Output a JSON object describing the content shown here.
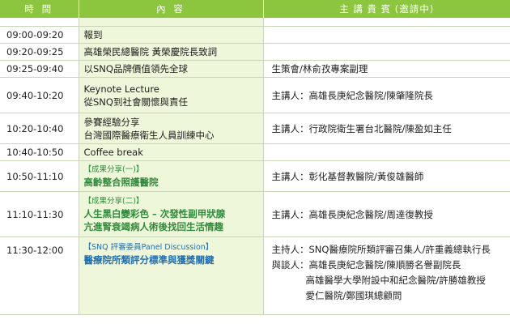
{
  "headers": {
    "time": "時 間",
    "content": "內 容",
    "host": "主 講 貴 賓 (邀請中)"
  },
  "rows": [
    {
      "time": "09:00-09:20",
      "content": [
        "報到"
      ],
      "host": []
    },
    {
      "time": "09:20-09:25",
      "content": [
        "高雄榮民總醫院 黃榮慶院長致詞"
      ],
      "host": []
    },
    {
      "time": "09:25-09:40",
      "content": [
        "以SNQ品牌價值領先全球"
      ],
      "host": [
        "生策會/林俞孜專案副理"
      ]
    },
    {
      "time": "09:40-10:20",
      "content": [
        "Keynote Lecture",
        "從SNQ到社會關懷與責任"
      ],
      "host": [
        "主講人：高雄長庚紀念醫院/陳肇隆院長"
      ]
    },
    {
      "time": "10:20-10:40",
      "content": [
        "參賽經驗分享",
        "台灣國際醫療衛生人員訓練中心"
      ],
      "host": [
        "主講人：行政院衛生署台北醫院/陳盈如主任"
      ]
    },
    {
      "time": "10:40-10:50",
      "content": [
        "Coffee break"
      ],
      "host": []
    },
    {
      "time": "10:50-11:10",
      "tag": "【成果分享(一)】",
      "title": [
        "高齡整合照護醫院"
      ],
      "style": "green",
      "host": [
        "主講人：彰化基督教醫院/黃俊雄醫師"
      ]
    },
    {
      "time": "11:10-11:30",
      "tag": "【成果分享(二)】",
      "title": [
        "人生黑白變彩色 – 次發性副甲狀腺",
        "亢進腎衰竭病人術後找回生活情趣"
      ],
      "style": "green",
      "host": [
        "主講人：高雄長庚紀念醫院/周達復教授"
      ]
    },
    {
      "time": "11:30-12:00",
      "tag": "【SNQ 評審委員Panel Discussion】",
      "title": [
        "醫療院所類評分標準與獲獎關鍵"
      ],
      "style": "blue",
      "host_lead": "主持人：SNQ醫療院所類評審召集人/許重義總執行長",
      "host_panel_label": "與談人：",
      "host_panel": [
        "高雄長庚紀念醫院/陳順勝名譽副院長",
        "高雄醫學大學附設中和紀念醫院/許勝雄教授",
        "愛仁醫院/鄭國琪總顧問"
      ]
    }
  ]
}
